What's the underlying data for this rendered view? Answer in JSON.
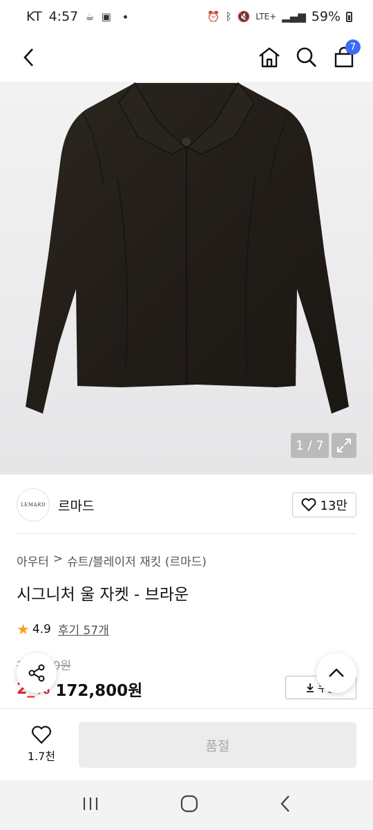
{
  "status_bar": {
    "carrier": "KT",
    "time": "4:57",
    "network": "LTE+",
    "battery": "59%"
  },
  "app_bar": {
    "cart_count": "7"
  },
  "gallery": {
    "counter": "1 / 7"
  },
  "brand": {
    "logo_text": "LEMARD",
    "name": "르마드",
    "likes": "13만"
  },
  "product": {
    "breadcrumb": [
      "아우터",
      ">",
      "슈트/블레이저 재킷 (르마드)"
    ],
    "title": "시그니처 울 자켓 - 브라운",
    "rating": "4.9",
    "reviews": "후기 57개",
    "original_price": "2__,_00원",
    "discount": "2_%",
    "price": "172,800원",
    "coupon_label": "쿠폰"
  },
  "bottom": {
    "wish_count": "1.7천",
    "buy_label": "품절"
  },
  "colors": {
    "accent": "#3d6df0",
    "sale": "#e1292b",
    "star": "#f6a31b"
  }
}
